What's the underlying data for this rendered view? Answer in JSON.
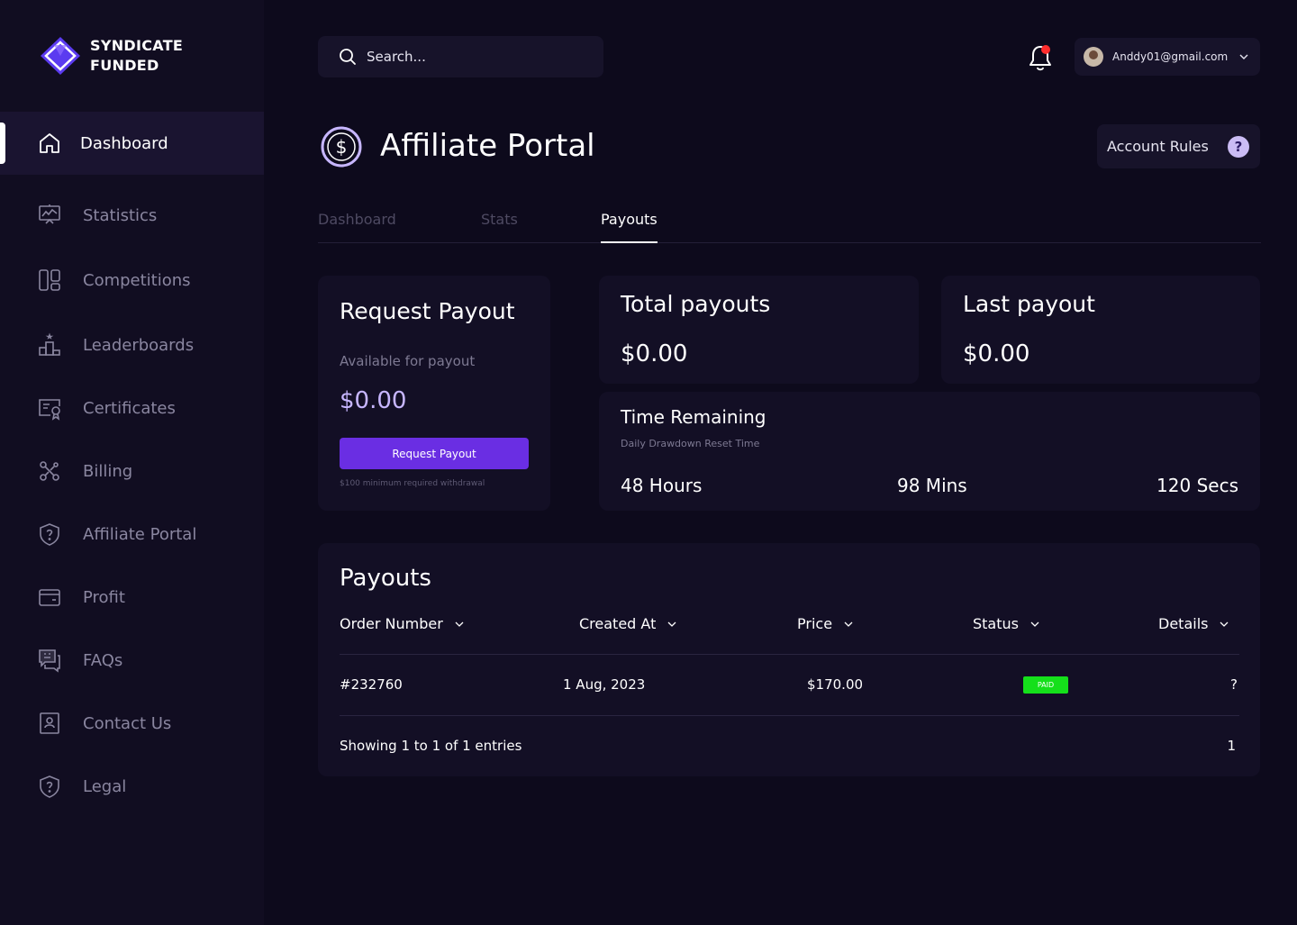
{
  "brand": {
    "line1": "SYNDICATE",
    "line2": "FUNDED"
  },
  "sidebar": {
    "items": [
      {
        "label": "Dashboard",
        "icon": "home-icon",
        "active": true
      },
      {
        "label": "Statistics",
        "icon": "chart-board-icon"
      },
      {
        "label": "Competitions",
        "icon": "layout-icon"
      },
      {
        "label": "Leaderboards",
        "icon": "podium-icon"
      },
      {
        "label": "Certificates",
        "icon": "certificate-icon"
      },
      {
        "label": "Billing",
        "icon": "network-icon"
      },
      {
        "label": "Affiliate Portal",
        "icon": "shield-question-icon"
      },
      {
        "label": "Profit",
        "icon": "wallet-icon"
      },
      {
        "label": "FAQs",
        "icon": "chat-question-icon"
      },
      {
        "label": "Contact Us",
        "icon": "contact-card-icon"
      },
      {
        "label": "Legal",
        "icon": "shield-question-icon"
      }
    ]
  },
  "search": {
    "placeholder": "Search..."
  },
  "user": {
    "email": "Anddy01@gmail.com"
  },
  "page": {
    "title": "Affiliate Portal",
    "rules_label": "Account Rules"
  },
  "tabs": [
    {
      "label": "Dashboard"
    },
    {
      "label": "Stats"
    },
    {
      "label": "Payouts",
      "active": true
    }
  ],
  "request": {
    "title": "Request Payout",
    "subtitle": "Available for payout",
    "amount": "$0.00",
    "button": "Request Payout",
    "note": "$100 minimum required withdrawal"
  },
  "total": {
    "title": "Total payouts",
    "amount": "$0.00"
  },
  "last": {
    "title": "Last payout",
    "amount": "$0.00"
  },
  "time": {
    "title": "Time Remaining",
    "subtitle": "Daily Drawdown Reset Time",
    "hours": "48 Hours",
    "mins": "98 Mins",
    "secs": "120 Secs"
  },
  "payouts": {
    "title": "Payouts",
    "columns": [
      "Order Number",
      "Created At",
      "Price",
      "Status",
      "Details"
    ],
    "rows": [
      {
        "order": "#232760",
        "created": "1 Aug, 2023",
        "price": "$170.00",
        "status": "PAID",
        "details": "?"
      }
    ],
    "showing": "Showing 1 to 1 of 1 entries",
    "page": "1"
  },
  "colors": {
    "background": "#0d0a1c",
    "sidebar": "#110d21",
    "accent": "#6a2ee3",
    "accent_light": "#c7b6ff",
    "paid": "#15e01b",
    "notification": "#ff2d2d"
  }
}
